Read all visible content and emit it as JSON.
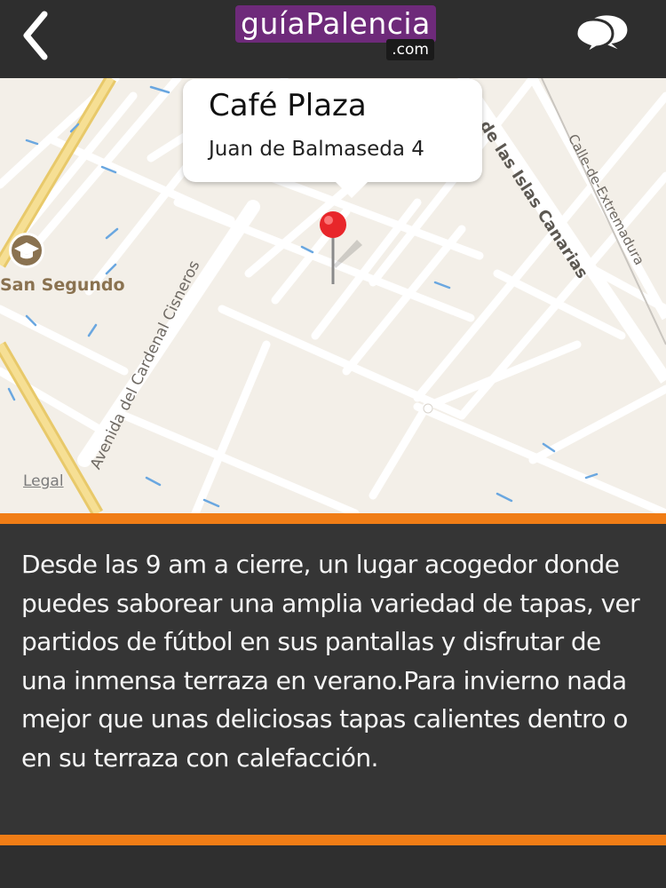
{
  "header": {
    "logo_main": "guíaPalencia",
    "logo_domain": ".com",
    "back_icon": "chevron-left-icon",
    "chat_icon": "chat-bubbles-icon"
  },
  "map": {
    "place": {
      "name": "Café Plaza",
      "address": "Juan de Balmaseda 4"
    },
    "poi": {
      "name": "San Segundo",
      "icon": "graduation-cap-icon"
    },
    "streets": {
      "cisneros": "Avenida del Cardenal Cisneros",
      "canarias": "de las Islas Canarias",
      "extremadura": "Calle-de-Extremadura"
    },
    "legal_link": "Legal"
  },
  "description": {
    "text": "Desde las 9 am a cierre, un lugar acogedor donde puedes saborear una amplia variedad de tapas, ver partidos de fútbol en sus pantallas y disfrutar de una inmensa terraza en verano.Para invierno nada mejor que unas deliciosas tapas calientes dentro o en su terraza con calefacción."
  },
  "colors": {
    "accent_orange": "#f07d16",
    "logo_purple": "#6e2a7a",
    "pin_red": "#e8262a",
    "header_bg": "#2e2e2e"
  }
}
